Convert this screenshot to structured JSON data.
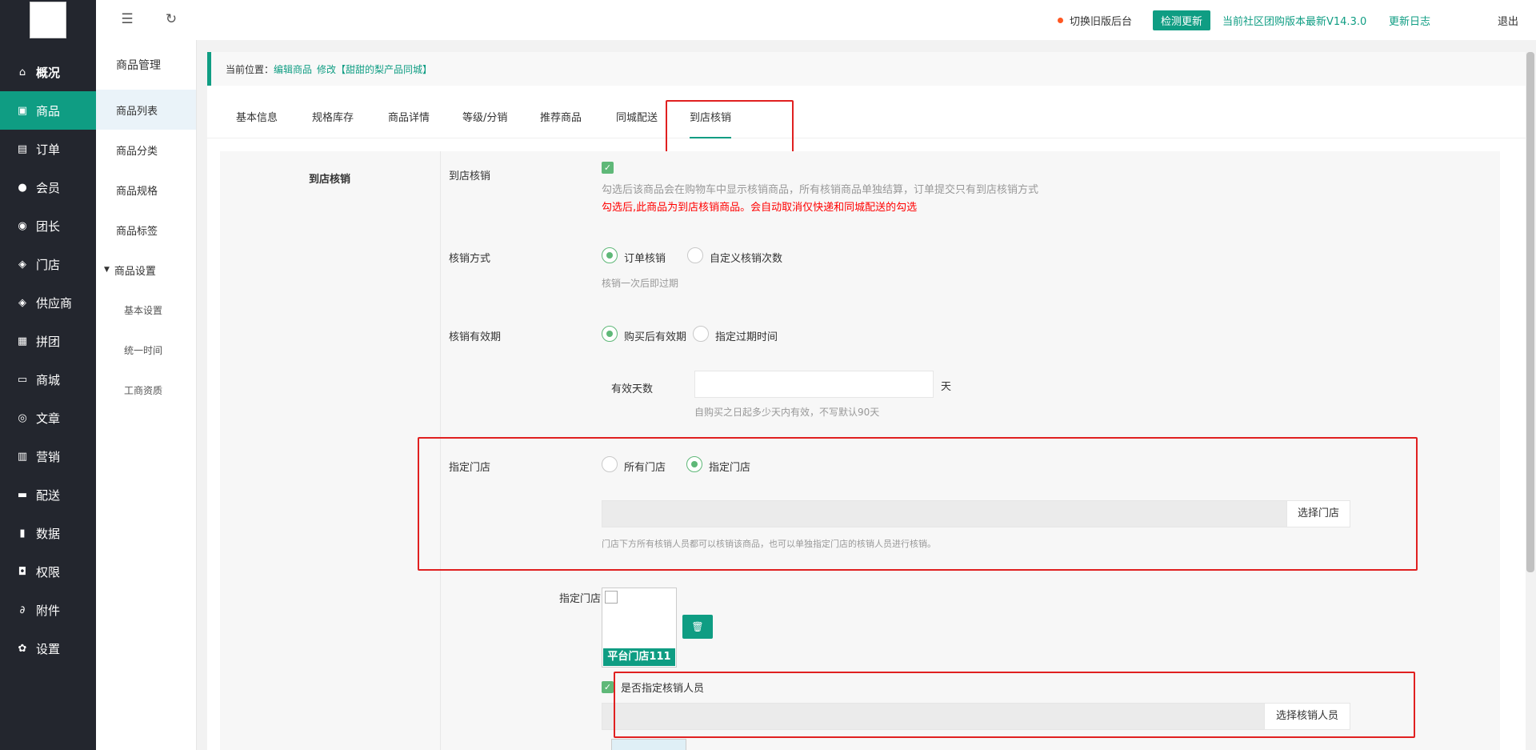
{
  "sidebar": {
    "items": [
      {
        "label": "概况",
        "icon": "home-icon",
        "glyph": "⌂"
      },
      {
        "label": "商品",
        "icon": "product-icon",
        "glyph": "▣"
      },
      {
        "label": "订单",
        "icon": "order-icon",
        "glyph": "▤"
      },
      {
        "label": "会员",
        "icon": "member-icon",
        "glyph": "●"
      },
      {
        "label": "团长",
        "icon": "leader-icon",
        "glyph": "◉"
      },
      {
        "label": "门店",
        "icon": "store-icon",
        "glyph": "◈"
      },
      {
        "label": "供应商",
        "icon": "supplier-icon",
        "glyph": "◈"
      },
      {
        "label": "拼团",
        "icon": "group-buy-icon",
        "glyph": "▦"
      },
      {
        "label": "商城",
        "icon": "mall-icon",
        "glyph": "▭"
      },
      {
        "label": "文章",
        "icon": "article-icon",
        "glyph": "◎"
      },
      {
        "label": "营销",
        "icon": "marketing-icon",
        "glyph": "▥"
      },
      {
        "label": "配送",
        "icon": "delivery-icon",
        "glyph": "▬"
      },
      {
        "label": "数据",
        "icon": "data-icon",
        "glyph": "▮"
      },
      {
        "label": "权限",
        "icon": "lock-icon",
        "glyph": "◘"
      },
      {
        "label": "附件",
        "icon": "attachment-icon",
        "glyph": "∂"
      },
      {
        "label": "设置",
        "icon": "gear-icon",
        "glyph": "✿"
      }
    ]
  },
  "submenu": {
    "title": "商品管理",
    "items": [
      "商品列表",
      "商品分类",
      "商品规格",
      "商品标签"
    ],
    "group": "商品设置",
    "children": [
      "基本设置",
      "统一时间",
      "工商资质"
    ]
  },
  "header": {
    "switch_old": "切换旧版后台",
    "check_update": "检测更新",
    "version_text": "当前社区团购版本最新V14.3.0",
    "changelog": "更新日志",
    "logout": "退出"
  },
  "breadcrumb": {
    "prefix": "当前位置：",
    "link1": "编辑商品",
    "link2": "修改【甜甜的梨产品同城】"
  },
  "tabs": [
    "基本信息",
    "规格库存",
    "商品详情",
    "等级/分销",
    "推荐商品",
    "同城配送",
    "到店核销"
  ],
  "form": {
    "section_title": "到店核销",
    "store_verify_label": "到店核销",
    "store_verify_hint": "勾选后该商品会在购物车中显示核销商品，所有核销商品单独结算，订单提交只有到店核销方式",
    "store_verify_warn": "勾选后,此商品为到店核销商品。会自动取消仅快递和同城配送的勾选",
    "method_label": "核销方式",
    "method_opt1": "订单核销",
    "method_opt2": "自定义核销次数",
    "method_hint": "核销一次后即过期",
    "validity_label": "核销有效期",
    "validity_opt1": "购买后有效期",
    "validity_opt2": "指定过期时间",
    "days_label": "有效天数",
    "days_value": "",
    "days_unit": "天",
    "days_hint": "自购买之日起多少天内有效，不写默认90天",
    "store_label": "指定门店",
    "store_opt1": "所有门店",
    "store_opt2": "指定门店",
    "store_value": "",
    "select_store_btn": "选择门店",
    "store_hint": "门店下方所有核销人员都可以核销该商品，也可以单独指定门店的核销人员进行核销。",
    "assigned_store_label": "指定门店1",
    "assigned_store_name": "平台门店111",
    "staff_check_label": "是否指定核销人员",
    "staff_value": "",
    "select_staff_btn": "选择核销人员"
  },
  "colors": {
    "accent": "#0f9d83",
    "sidebar_bg": "#23262e",
    "check_green": "#5fb878",
    "warning_red": "#ff0000",
    "highlight_box": "#e02020"
  }
}
